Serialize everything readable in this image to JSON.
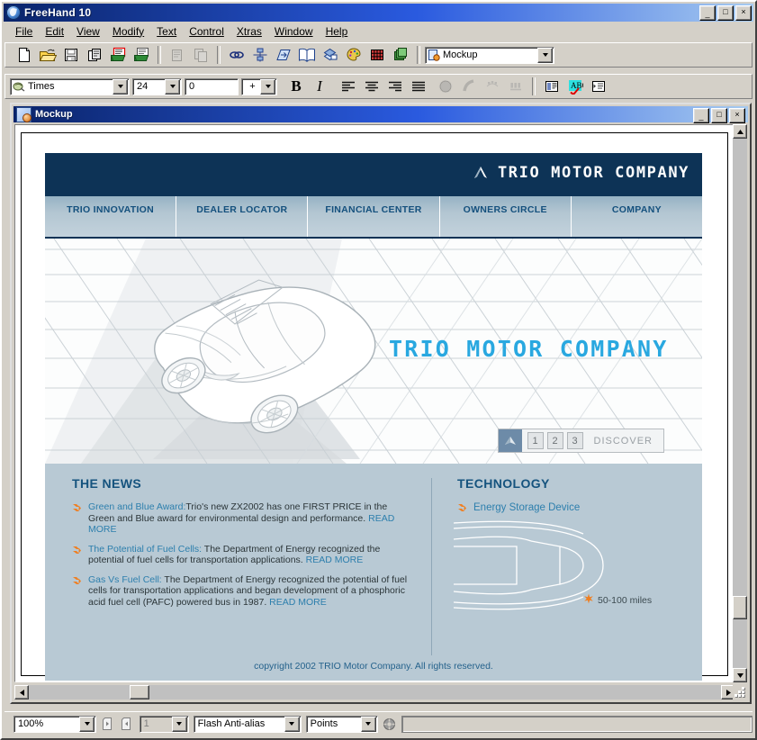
{
  "app": {
    "title": "FreeHand 10",
    "icon": "freehand-logo-icon",
    "window_buttons": {
      "minimize": "_",
      "maximize": "□",
      "close": "×"
    },
    "menus": [
      {
        "label": "File",
        "accel": "F"
      },
      {
        "label": "Edit",
        "accel": "E"
      },
      {
        "label": "View",
        "accel": "V"
      },
      {
        "label": "Modify",
        "accel": "M"
      },
      {
        "label": "Text",
        "accel": "T"
      },
      {
        "label": "Control",
        "accel": "C"
      },
      {
        "label": "Xtras",
        "accel": "X"
      },
      {
        "label": "Window",
        "accel": "W"
      },
      {
        "label": "Help",
        "accel": "H"
      }
    ]
  },
  "main_toolbar": {
    "buttons": [
      {
        "name": "new-document-icon",
        "title": "New"
      },
      {
        "name": "open-folder-icon",
        "title": "Open"
      },
      {
        "name": "save-disk-icon",
        "title": "Save"
      },
      {
        "name": "print-icon",
        "title": "Print"
      },
      {
        "name": "import-icon",
        "title": "Import"
      },
      {
        "name": "export-icon",
        "title": "Export"
      },
      {
        "name": "cut-icon",
        "title": "Cut"
      },
      {
        "name": "copy-icon",
        "title": "Copy"
      },
      {
        "name": "links-icon",
        "title": "Links"
      },
      {
        "name": "align-icon",
        "title": "Align"
      },
      {
        "name": "transform-icon",
        "title": "Transform"
      },
      {
        "name": "library-icon",
        "title": "Library"
      },
      {
        "name": "layers-panel-icon",
        "title": "Layers"
      },
      {
        "name": "color-palette-icon",
        "title": "Swatches"
      },
      {
        "name": "grid-icon",
        "title": "Grid"
      },
      {
        "name": "pages-icon",
        "title": "Pages"
      }
    ],
    "document_combo": {
      "value": "Mockup",
      "icon": "document-icon"
    }
  },
  "text_toolbar": {
    "font_combo": {
      "value": "Times",
      "icon": "font-icon"
    },
    "size_combo": {
      "value": "24"
    },
    "leading_field": {
      "value": "0"
    },
    "leading_mode_combo": {
      "value": "+"
    },
    "bold_label": "B",
    "italic_label": "I",
    "buttons": [
      {
        "name": "align-left-icon",
        "title": "Align left"
      },
      {
        "name": "align-center-icon",
        "title": "Align center"
      },
      {
        "name": "align-right-icon",
        "title": "Align right"
      },
      {
        "name": "align-justify-icon",
        "title": "Justify"
      },
      {
        "name": "text-wrap-icon",
        "title": "Run around selection"
      },
      {
        "name": "attach-to-path-icon",
        "title": "Attach to path"
      },
      {
        "name": "flow-inside-path-icon",
        "title": "Flow inside path"
      },
      {
        "name": "convert-to-paths-icon",
        "title": "Convert to paths"
      },
      {
        "name": "text-columns-icon",
        "title": "Columns"
      },
      {
        "name": "spell-check-icon",
        "title": "Spelling"
      },
      {
        "name": "text-indent-icon",
        "title": "Indent"
      }
    ]
  },
  "document_window": {
    "title": "Mockup",
    "icon": "document-window-icon",
    "window_buttons": {
      "minimize": "_",
      "maximize": "□",
      "close": "×"
    }
  },
  "mockup": {
    "brand": "TRIO MOTOR COMPANY",
    "logo_mark": "triangle-chevron-icon",
    "nav": [
      {
        "label": "TRIO INNOVATION"
      },
      {
        "label": "DEALER LOCATOR"
      },
      {
        "label": "FINANCIAL CENTER"
      },
      {
        "label": "OWNERS CIRCLE"
      },
      {
        "label": "COMPANY"
      }
    ],
    "hero": {
      "headline": "TRIO MOTOR COMPANY",
      "car_graphic": "concept-car-wireframe",
      "pager": {
        "home_icon": "triangle-up-icon",
        "numbers": [
          "1",
          "2",
          "3"
        ],
        "label": "DISCOVER"
      }
    },
    "news": {
      "heading": "THE NEWS",
      "items": [
        {
          "bullet": "orange-arrow-bullet-icon",
          "link": "Green and Blue Award:",
          "body": "Trio's new ZX2002 has one FIRST PRICE in the Green and Blue award for environmental design and performance. ",
          "read_more": "READ MORE"
        },
        {
          "bullet": "orange-arrow-bullet-icon",
          "link": "The Potential of Fuel Cells:",
          "body": " The Department of Energy recognized the potential of fuel cells for transportation applications. ",
          "read_more": "READ MORE"
        },
        {
          "bullet": "orange-arrow-bullet-icon",
          "link": "Gas Vs Fuel Cell:",
          "body": " The Department of Energy recognized the potential of fuel cells for transportation applications and began development of a phosphoric acid fuel cell (PAFC) powered bus in 1987. ",
          "read_more": "READ MORE"
        }
      ]
    },
    "technology": {
      "heading": "TECHNOLOGY",
      "item": {
        "bullet": "orange-arrow-bullet-icon",
        "label": "Energy Storage Device"
      },
      "diagram": "car-topview-wireframe",
      "note": {
        "marker": "orange-star-icon",
        "text": "50-100 miles"
      }
    },
    "copyright": "copyright 2002 TRIO Motor Company. All rights reserved.",
    "colors": {
      "header_navy": "#0d3356",
      "nav_blue": "#b3c6d2",
      "nav_text": "#14507d",
      "hero_cyan": "#29a8e0",
      "content_blue": "#b8c9d4",
      "accent_orange": "#ef7f22",
      "link_blue": "#2d7fad"
    }
  },
  "status_bar": {
    "zoom_combo": {
      "value": "100%"
    },
    "prev_page_icon": "previous-page-icon",
    "next_page_icon": "next-page-icon",
    "page_field": {
      "value": "1"
    },
    "antialias_combo": {
      "value": "Flash Anti-alias"
    },
    "units_combo": {
      "value": "Points"
    },
    "help_icon": "help-wheel-icon",
    "message_field": {
      "value": ""
    }
  }
}
